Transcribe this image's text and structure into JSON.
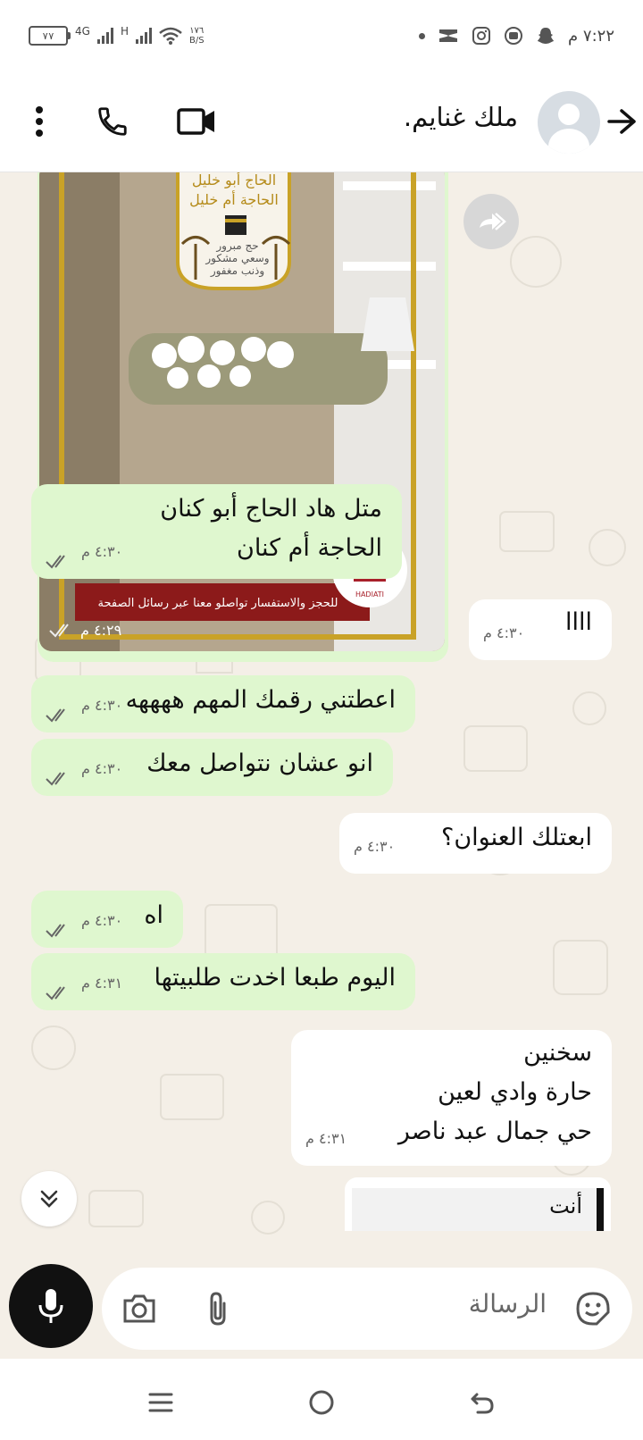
{
  "status_bar": {
    "battery": "٧٧",
    "net_1": "4G",
    "net_2": "H",
    "speed_value": "١٧٦",
    "speed_unit": "B/S",
    "time": "٧:٢٢ م"
  },
  "header": {
    "contact_name": "ملك غنايم."
  },
  "image_message": {
    "time": "٤:٢٩ م",
    "poster_line_1": "الحاج أبو خليل",
    "poster_line_2": "الحاجة أم خليل",
    "poster_line_3": "حج مبرور",
    "poster_line_4": "وسعي مشكور",
    "poster_line_5": "وذنب مغفور",
    "poster_footer": "للحجز والاستفسار تواصلو معنا عبر رسائل الصفحة",
    "logo_text": "HADIATI"
  },
  "messages": [
    {
      "dir": "in",
      "lines": [
        "متل هاد الحاج أبو كنان",
        "الحاجة أم كنان"
      ],
      "time": "٤:٣٠ م"
    },
    {
      "dir": "out",
      "lines": [
        "اااا"
      ],
      "time": "٤:٣٠ م"
    },
    {
      "dir": "in",
      "lines": [
        "اعطتني رقمك المهم ههههه"
      ],
      "time": "٤:٣٠ م"
    },
    {
      "dir": "in",
      "lines": [
        "انو عشان نتواصل معك"
      ],
      "time": "٤:٣٠ م"
    },
    {
      "dir": "out",
      "lines": [
        "ابعتلك العنوان؟"
      ],
      "time": "٤:٣٠ م"
    },
    {
      "dir": "in",
      "lines": [
        "اه"
      ],
      "time": "٤:٣٠ م"
    },
    {
      "dir": "in",
      "lines": [
        "اليوم طبعا اخدت طلبيتها"
      ],
      "time": "٤:٣١ م"
    },
    {
      "dir": "out",
      "lines": [
        "سخنين",
        "حارة وادي لعين",
        "حي جمال عبد ناصر"
      ],
      "time": "٤:٣١ م"
    }
  ],
  "reply_preview": {
    "author": "أنت"
  },
  "composer": {
    "placeholder": "الرسالة"
  }
}
